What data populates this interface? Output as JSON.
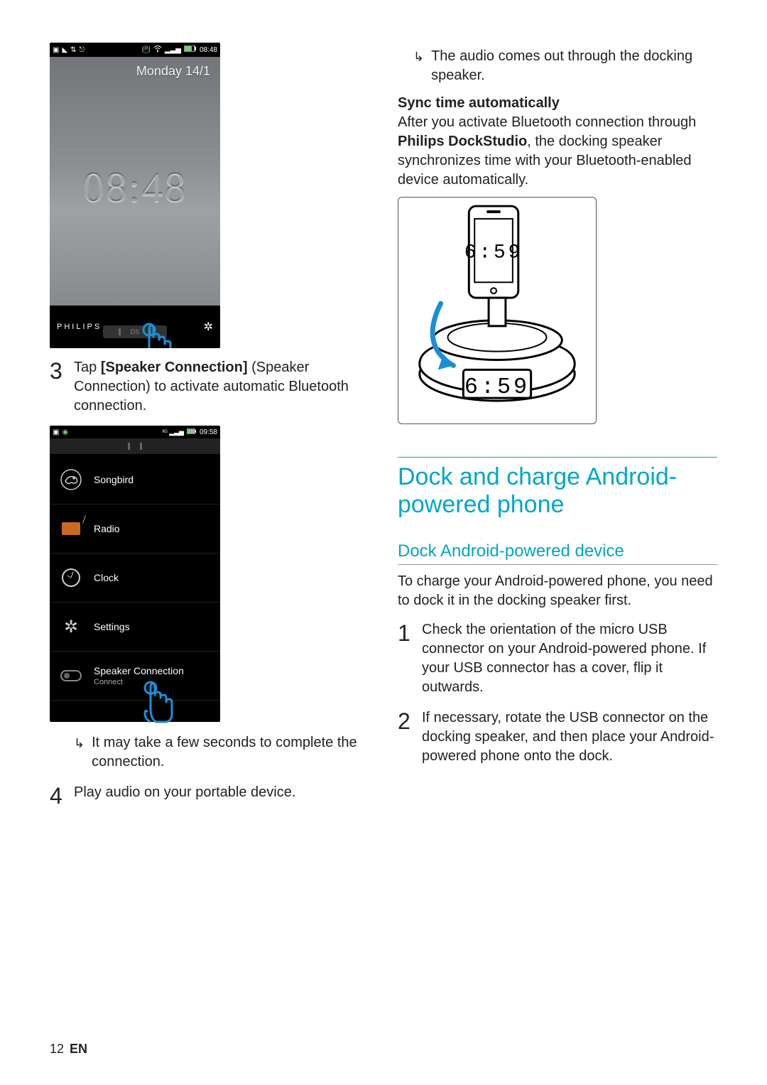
{
  "phone_lock": {
    "status_time": "08:48",
    "date": "Monday 14/1",
    "clock": "08:48",
    "brand": "PHILIPS",
    "dock_label": "DS"
  },
  "left": {
    "step3_num": "3",
    "step3_text_pre": "Tap ",
    "step3_bold": "[Speaker Connection]",
    "step3_text_post": " (Speaker Connection) to activate automatic Bluetooth connection.",
    "menu_status_time": "09:58",
    "menu_items": [
      {
        "label": "Songbird"
      },
      {
        "label": "Radio"
      },
      {
        "label": "Clock"
      },
      {
        "label": "Settings"
      },
      {
        "label": "Speaker Connection",
        "sub": "Connect"
      }
    ],
    "result3": "It may take a few seconds to complete the connection.",
    "step4_num": "4",
    "step4_text": "Play audio on your portable device."
  },
  "right": {
    "result_top": "The audio comes out through the docking speaker.",
    "sync_head": "Sync time automatically",
    "sync_body_pre": "After you activate Bluetooth connection through ",
    "sync_body_bold": "Philips DockStudio",
    "sync_body_post": ", the docking speaker synchronizes time with your Bluetooth-enabled device automatically.",
    "ill_time_phone": "6:59",
    "ill_time_dock": "6:59",
    "h2": "Dock and charge Android-powered phone",
    "h3": "Dock Android-powered device",
    "intro": "To charge your Android-powered phone, you need to dock it in the docking speaker first.",
    "step1_num": "1",
    "step1_text": "Check the orientation of the micro USB connector on your Android-powered phone. If your USB connector has a cover, flip it outwards.",
    "step2_num": "2",
    "step2_text": "If necessary, rotate the USB connector on the docking speaker, and then place your Android-powered phone onto the dock."
  },
  "footer": {
    "pagenum": "12",
    "lang": "EN"
  }
}
